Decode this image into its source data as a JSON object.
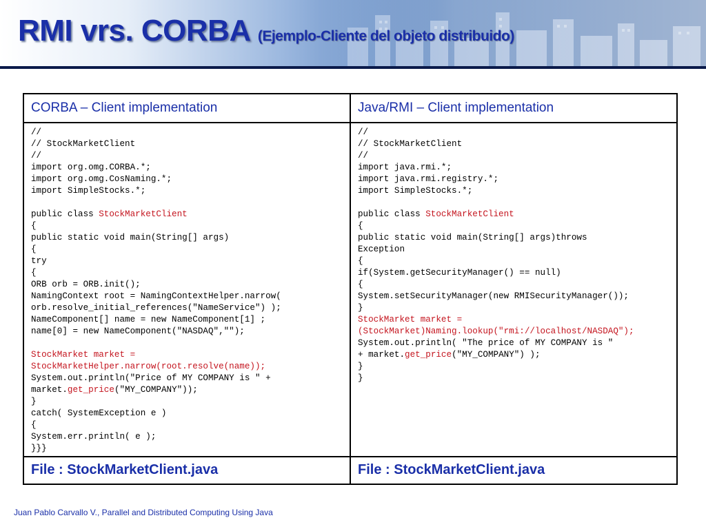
{
  "slide": {
    "title": "RMI vrs. CORBA",
    "subtitle": "(Ejemplo-Cliente del objeto distribuido)",
    "footer": "Juan Pablo Carvallo V., Parallel and Distributed Computing Using Java"
  },
  "colors": {
    "title": "#1a2fa8",
    "header_text": "#1a2fa8",
    "highlight": "#c4141e",
    "rule": "#0a1a4a"
  },
  "table": {
    "left": {
      "header": "CORBA – Client implementation",
      "footer": "File : StockMarketClient.java",
      "lines": [
        [
          {
            "t": "//"
          }
        ],
        [
          {
            "t": "// StockMarketClient"
          }
        ],
        [
          {
            "t": "//"
          }
        ],
        [
          {
            "t": "import org.omg.CORBA.*;"
          }
        ],
        [
          {
            "t": "import org.omg.CosNaming.*;"
          }
        ],
        [
          {
            "t": "import SimpleStocks.*;"
          }
        ],
        [],
        [
          {
            "t": "public class "
          },
          {
            "t": "StockMarketClient",
            "hl": true
          }
        ],
        [
          {
            "t": "{"
          }
        ],
        [
          {
            "t": "public static void main(String[] args)"
          }
        ],
        [
          {
            "t": "{"
          }
        ],
        [
          {
            "t": "try"
          }
        ],
        [
          {
            "t": "{"
          }
        ],
        [
          {
            "t": "ORB orb = ORB.init();"
          }
        ],
        [
          {
            "t": "NamingContext root = NamingContextHelper.narrow("
          }
        ],
        [
          {
            "t": "orb.resolve_initial_references(\"NameService\") );"
          }
        ],
        [
          {
            "t": "NameComponent[] name = new NameComponent[1] ;"
          }
        ],
        [
          {
            "t": "name[0] = new NameComponent(\"NASDAQ\",\"\");"
          }
        ],
        [],
        [
          {
            "t": "StockMarket market =",
            "hl": true
          }
        ],
        [
          {
            "t": "StockMarketHelper.narrow(root.resolve(name));",
            "hl": true
          }
        ],
        [
          {
            "t": "System.out.println(\"Price of MY COMPANY is \" +"
          }
        ],
        [
          {
            "t": "market."
          },
          {
            "t": "get_price",
            "hl": true
          },
          {
            "t": "(\"MY_COMPANY\"));"
          }
        ],
        [
          {
            "t": "}"
          }
        ],
        [
          {
            "t": "catch( SystemException e )"
          }
        ],
        [
          {
            "t": "{"
          }
        ],
        [
          {
            "t": "System.err.println( e );"
          }
        ],
        [
          {
            "t": "}}}"
          }
        ]
      ]
    },
    "right": {
      "header": "Java/RMI – Client implementation",
      "footer": "File : StockMarketClient.java",
      "lines": [
        [
          {
            "t": "//"
          }
        ],
        [
          {
            "t": "// StockMarketClient"
          }
        ],
        [
          {
            "t": "//"
          }
        ],
        [
          {
            "t": "import java.rmi.*;"
          }
        ],
        [
          {
            "t": "import java.rmi.registry.*;"
          }
        ],
        [
          {
            "t": "import SimpleStocks.*;"
          }
        ],
        [],
        [
          {
            "t": "public class "
          },
          {
            "t": "StockMarketClient",
            "hl": true
          }
        ],
        [
          {
            "t": "{"
          }
        ],
        [
          {
            "t": "public static void main(String[] args)throws"
          }
        ],
        [
          {
            "t": "Exception"
          }
        ],
        [
          {
            "t": "{"
          }
        ],
        [
          {
            "t": "if(System.getSecurityManager() == null)"
          }
        ],
        [
          {
            "t": "{"
          }
        ],
        [
          {
            "t": "System.setSecurityManager(new RMISecurityManager());"
          }
        ],
        [
          {
            "t": "}"
          }
        ],
        [
          {
            "t": "StockMarket market =",
            "hl": true
          }
        ],
        [
          {
            "t": "(StockMarket)Naming.lookup(\"rmi://localhost/NASDAQ\");",
            "hl": true
          }
        ],
        [
          {
            "t": "System.out.println( \"The price of MY COMPANY is \""
          }
        ],
        [
          {
            "t": "+ market."
          },
          {
            "t": "get_price",
            "hl": true
          },
          {
            "t": "(\"MY_COMPANY\") );"
          }
        ],
        [
          {
            "t": "}"
          }
        ],
        [
          {
            "t": "}"
          }
        ]
      ]
    }
  }
}
